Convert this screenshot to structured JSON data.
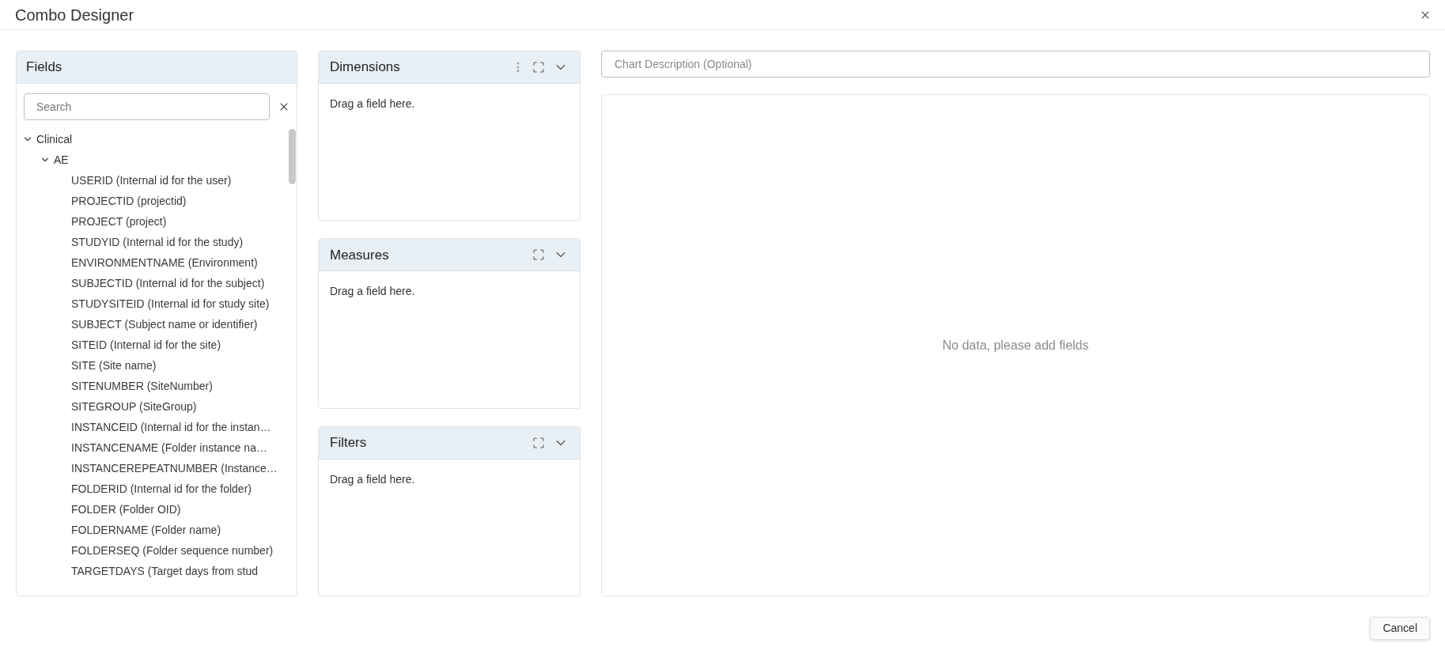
{
  "dialog": {
    "title": "Combo Designer"
  },
  "fields_panel": {
    "title": "Fields",
    "search": {
      "placeholder": "Search"
    },
    "tree": [
      {
        "label": "Clinical",
        "expanded": true,
        "children": [
          {
            "label": "AE",
            "expanded": true,
            "children": [
              {
                "label": "USERID (Internal id for the user)"
              },
              {
                "label": "PROJECTID (projectid)"
              },
              {
                "label": "PROJECT (project)"
              },
              {
                "label": "STUDYID (Internal id for the study)"
              },
              {
                "label": "ENVIRONMENTNAME (Environment)"
              },
              {
                "label": "SUBJECTID (Internal id for the subject)"
              },
              {
                "label": "STUDYSITEID (Internal id for study site)"
              },
              {
                "label": "SUBJECT (Subject name or identifier)"
              },
              {
                "label": "SITEID (Internal id for the site)"
              },
              {
                "label": "SITE (Site name)"
              },
              {
                "label": "SITENUMBER (SiteNumber)"
              },
              {
                "label": "SITEGROUP (SiteGroup)"
              },
              {
                "label": "INSTANCEID (Internal id for the instan…"
              },
              {
                "label": "INSTANCENAME (Folder instance na…"
              },
              {
                "label": "INSTANCEREPEATNUMBER (Instance…"
              },
              {
                "label": "FOLDERID (Internal id for the folder)"
              },
              {
                "label": "FOLDER (Folder OID)"
              },
              {
                "label": "FOLDERNAME (Folder name)"
              },
              {
                "label": "FOLDERSEQ (Folder sequence number)"
              },
              {
                "label": "TARGETDAYS (Target days from stud"
              }
            ]
          }
        ]
      }
    ]
  },
  "drop_zones": [
    {
      "title": "Dimensions",
      "hint": "Drag a field here.",
      "menu": true
    },
    {
      "title": "Measures",
      "hint": "Drag a field here.",
      "menu": false
    },
    {
      "title": "Filters",
      "hint": "Drag a field here.",
      "menu": false
    }
  ],
  "chart": {
    "description": {
      "placeholder": "Chart Description (Optional)"
    },
    "empty_message": "No data, please add fields"
  },
  "buttons": [
    "Cancel"
  ]
}
